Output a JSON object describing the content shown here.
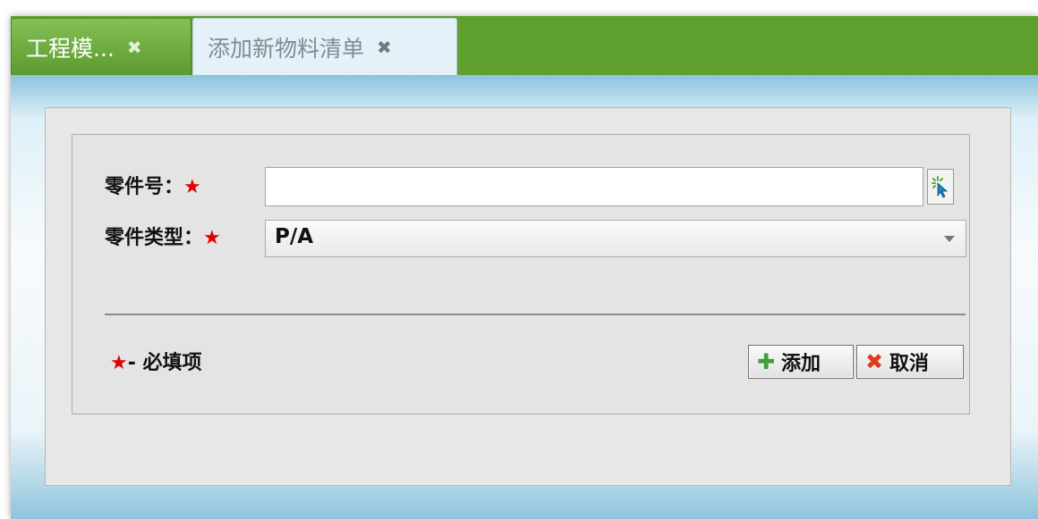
{
  "tabs": [
    {
      "label": "工程模...",
      "close": "✖"
    },
    {
      "label": "添加新物料清单",
      "close": "✖"
    }
  ],
  "form": {
    "part_number_label": "零件号：",
    "part_type_label": "零件类型：",
    "required_mark": "★",
    "part_number_value": "",
    "part_type_value": "P/A",
    "required_note_mark": "★",
    "required_note_text": "- 必填项"
  },
  "buttons": {
    "add_label": "添加",
    "cancel_label": "取消"
  },
  "icons": {
    "add": "plus-icon",
    "cancel": "x-icon",
    "picker": "cursor-select-icon"
  },
  "colors": {
    "tab_bar": "#5e9f2d",
    "required": "#e00000",
    "add_icon": "#3ca038",
    "cancel_icon": "#e03a1e"
  }
}
